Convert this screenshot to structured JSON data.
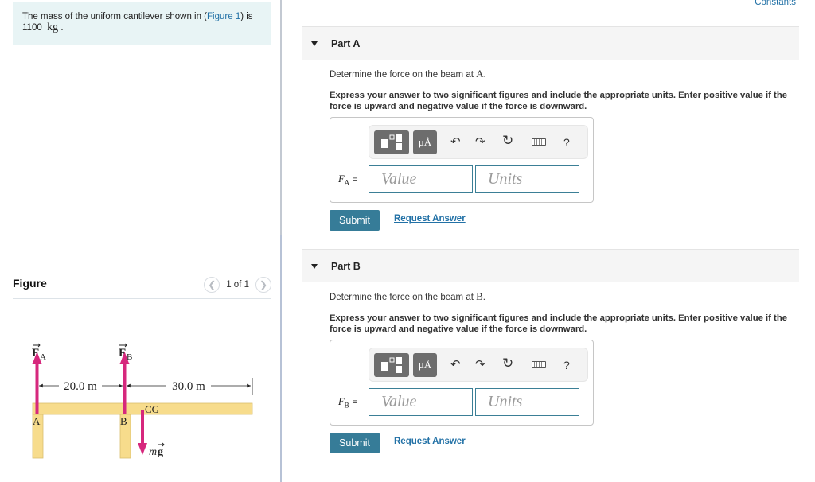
{
  "problem": {
    "text_before_link": "The mass of the uniform cantilever shown in (",
    "link": "Figure 1",
    "text_after_link": ") is",
    "mass_value": "1100",
    "mass_unit": "kg",
    "trailing": "."
  },
  "figure": {
    "title": "Figure",
    "pager": "1 of 1",
    "prev_icon": "chevron-left",
    "next_icon": "chevron-right",
    "diagram": {
      "force_a_label": "F",
      "force_a_sub": "A",
      "force_b_label": "F",
      "force_b_sub": "B",
      "dim_1": "20.0 m",
      "dim_2": "30.0 m",
      "support_a": "A",
      "support_b": "B",
      "cg_label": "CG",
      "weight_label_m": "m",
      "weight_label_g": "g",
      "beam_color": "#f7dc8c",
      "arrow_color": "#d6287d"
    }
  },
  "header": {
    "constants_link": "Constants"
  },
  "parts": [
    {
      "title": "Part A",
      "question_prefix": "Determine the force on the beam at ",
      "point": "A",
      "question_suffix": ".",
      "instructions": "Express your answer to two significant figures and include the appropriate units. Enter positive value if the force is upward and negative value if the force is downward.",
      "variable": "F",
      "variable_sub": "A",
      "equals": "=",
      "value_placeholder": "Value",
      "units_placeholder": "Units",
      "toolbar": {
        "units_button": "μÅ",
        "undo_icon": "undo",
        "redo_icon": "redo",
        "reset_icon": "reset",
        "keyboard_icon": "keyboard",
        "help": "?"
      },
      "submit": "Submit",
      "request_answer": "Request Answer"
    },
    {
      "title": "Part B",
      "question_prefix": "Determine the force on the beam at ",
      "point": "B",
      "question_suffix": ".",
      "instructions": "Express your answer to two significant figures and include the appropriate units. Enter positive value if the force is upward and negative value if the force is downward.",
      "variable": "F",
      "variable_sub": "B",
      "equals": "=",
      "value_placeholder": "Value",
      "units_placeholder": "Units",
      "toolbar": {
        "units_button": "μÅ",
        "undo_icon": "undo",
        "redo_icon": "redo",
        "reset_icon": "reset",
        "keyboard_icon": "keyboard",
        "help": "?"
      },
      "submit": "Submit",
      "request_answer": "Request Answer"
    }
  ],
  "colors": {
    "accent": "#367c98",
    "link": "#2271a6",
    "problem_bg": "#e8f4f5"
  }
}
